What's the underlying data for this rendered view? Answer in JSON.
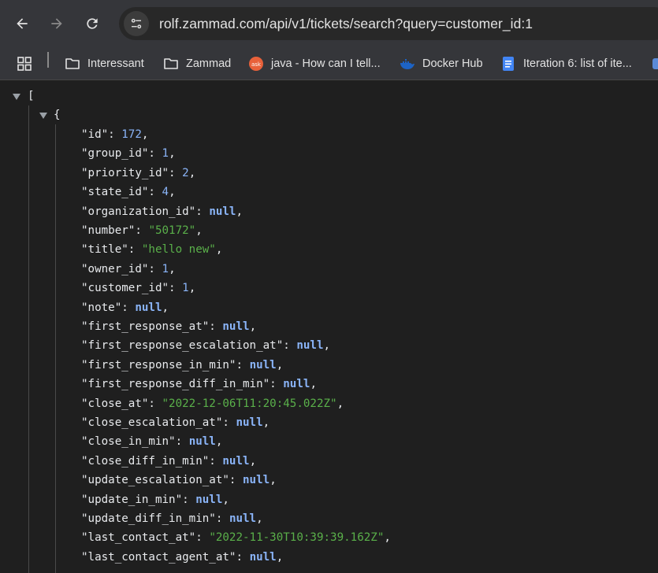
{
  "toolbar": {
    "url": "rolf.zammad.com/api/v1/tickets/search?query=customer_id:1"
  },
  "bookmarks": [
    {
      "label": "Interessant",
      "icon": "folder-icon"
    },
    {
      "label": "Zammad",
      "icon": "folder-icon"
    },
    {
      "label": "java - How can I tell...",
      "icon": "askubuntu-icon"
    },
    {
      "label": "Docker Hub",
      "icon": "docker-icon"
    },
    {
      "label": "Iteration 6: list of ite...",
      "icon": "google-docs-icon"
    }
  ],
  "json": {
    "open_bracket": "[",
    "open_brace": "{",
    "fields": [
      {
        "key": "\"id\"",
        "value": "172",
        "type": "num"
      },
      {
        "key": "\"group_id\"",
        "value": "1",
        "type": "num"
      },
      {
        "key": "\"priority_id\"",
        "value": "2",
        "type": "num"
      },
      {
        "key": "\"state_id\"",
        "value": "4",
        "type": "num"
      },
      {
        "key": "\"organization_id\"",
        "value": "null",
        "type": "nul"
      },
      {
        "key": "\"number\"",
        "value": "\"50172\"",
        "type": "str"
      },
      {
        "key": "\"title\"",
        "value": "\"hello new\"",
        "type": "str"
      },
      {
        "key": "\"owner_id\"",
        "value": "1",
        "type": "num"
      },
      {
        "key": "\"customer_id\"",
        "value": "1",
        "type": "num"
      },
      {
        "key": "\"note\"",
        "value": "null",
        "type": "nul"
      },
      {
        "key": "\"first_response_at\"",
        "value": "null",
        "type": "nul"
      },
      {
        "key": "\"first_response_escalation_at\"",
        "value": "null",
        "type": "nul"
      },
      {
        "key": "\"first_response_in_min\"",
        "value": "null",
        "type": "nul"
      },
      {
        "key": "\"first_response_diff_in_min\"",
        "value": "null",
        "type": "nul"
      },
      {
        "key": "\"close_at\"",
        "value": "\"2022-12-06T11:20:45.022Z\"",
        "type": "str"
      },
      {
        "key": "\"close_escalation_at\"",
        "value": "null",
        "type": "nul"
      },
      {
        "key": "\"close_in_min\"",
        "value": "null",
        "type": "nul"
      },
      {
        "key": "\"close_diff_in_min\"",
        "value": "null",
        "type": "nul"
      },
      {
        "key": "\"update_escalation_at\"",
        "value": "null",
        "type": "nul"
      },
      {
        "key": "\"update_in_min\"",
        "value": "null",
        "type": "nul"
      },
      {
        "key": "\"update_diff_in_min\"",
        "value": "null",
        "type": "nul"
      },
      {
        "key": "\"last_contact_at\"",
        "value": "\"2022-11-30T10:39:39.162Z\"",
        "type": "str"
      },
      {
        "key": "\"last_contact_agent_at\"",
        "value": "null",
        "type": "nul"
      }
    ]
  }
}
